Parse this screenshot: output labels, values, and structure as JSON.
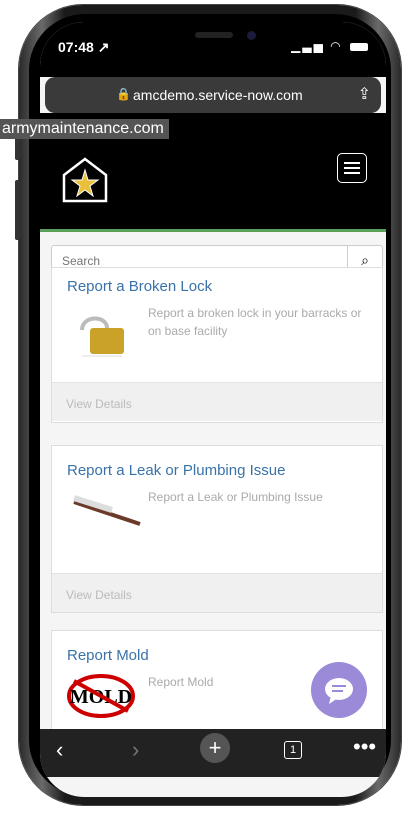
{
  "status": {
    "time": "07:48 ↗"
  },
  "browser": {
    "url": "amcdemo.service-now.com"
  },
  "overlay": {
    "label": "armymaintenance.com"
  },
  "search": {
    "placeholder": "Search"
  },
  "cards": [
    {
      "title": "Report a Broken Lock",
      "description": "Report a broken lock in your barracks or on base facility",
      "footer": "View Details"
    },
    {
      "title": "Report a Leak or Plumbing Issue",
      "description": "Report a Leak or Plumbing Issue",
      "footer": "View Details"
    },
    {
      "title": "Report Mold",
      "description": "Report Mold"
    }
  ],
  "toolbar": {
    "tab_count": "1"
  },
  "colors": {
    "accent": "#3a72a8",
    "chat": "#9a8ad8",
    "header_border": "#5aa05a"
  }
}
